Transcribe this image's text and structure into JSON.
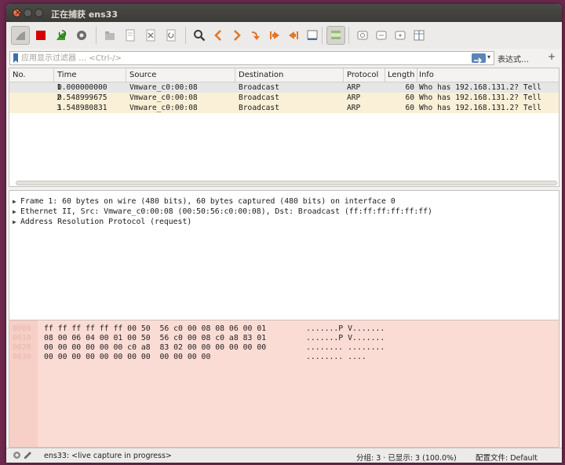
{
  "window": {
    "title": "正在捕获 ens33"
  },
  "filter": {
    "placeholder": "应用显示过滤器 … <Ctrl-/>",
    "expression_label": "表达式…",
    "add_label": "+"
  },
  "packet_list": {
    "columns": [
      "No.",
      "Time",
      "Source",
      "Destination",
      "Protocol",
      "Length",
      "Info"
    ],
    "rows": [
      {
        "no": "1",
        "time": "0.000000000",
        "source": "Vmware_c0:00:08",
        "destination": "Broadcast",
        "protocol": "ARP",
        "length": "60",
        "info": "Who has 192.168.131.2? Tell"
      },
      {
        "no": "2",
        "time": "0.548999675",
        "source": "Vmware_c0:00:08",
        "destination": "Broadcast",
        "protocol": "ARP",
        "length": "60",
        "info": "Who has 192.168.131.2? Tell"
      },
      {
        "no": "3",
        "time": "1.548980831",
        "source": "Vmware_c0:00:08",
        "destination": "Broadcast",
        "protocol": "ARP",
        "length": "60",
        "info": "Who has 192.168.131.2? Tell"
      }
    ]
  },
  "details": {
    "lines": [
      "Frame 1: 60 bytes on wire (480 bits), 60 bytes captured (480 bits) on interface 0",
      "Ethernet II, Src: Vmware_c0:00:08 (00:50:56:c0:00:08), Dst: Broadcast (ff:ff:ff:ff:ff:ff)",
      "Address Resolution Protocol (request)"
    ]
  },
  "bytes": {
    "rows": [
      {
        "offset": "0000",
        "hex": "ff ff ff ff ff ff 00 50  56 c0 00 08 08 06 00 01",
        "ascii": ".......P V......."
      },
      {
        "offset": "0010",
        "hex": "08 00 06 04 00 01 00 50  56 c0 00 08 c0 a8 83 01",
        "ascii": ".......P V......."
      },
      {
        "offset": "0020",
        "hex": "00 00 00 00 00 00 c0 a8  83 02 00 00 00 00 00 00",
        "ascii": "........ ........"
      },
      {
        "offset": "0030",
        "hex": "00 00 00 00 00 00 00 00  00 00 00 00",
        "ascii": "........ ...."
      }
    ]
  },
  "status": {
    "capture_text": "ens33: <live capture in progress>",
    "packets_text": "分组: 3 · 已显示: 3 (100.0%)",
    "profile_text": "配置文件: Default"
  },
  "colors": {
    "row_highlight": "#faf0d7",
    "selected_row": "#e6e6e6",
    "bytes_bg": "#fbdcd5",
    "stop_red": "#d40000",
    "nav_orange": "#e0772a",
    "shark_green": "#3c9c2a"
  },
  "icons": [
    "shark-fin-start-icon",
    "stop-capture-icon",
    "restart-capture-icon",
    "capture-options-icon",
    "open-file-icon",
    "save-file-icon",
    "close-file-icon",
    "reload-icon",
    "find-packet-icon",
    "go-back-icon",
    "go-forward-icon",
    "go-to-packet-icon",
    "go-first-icon",
    "go-last-icon",
    "autoscroll-icon",
    "colorize-icon",
    "zoom-in-icon",
    "zoom-out-icon",
    "normal-size-icon",
    "resize-columns-icon",
    "bookmark-icon",
    "expert-info-icon",
    "edit-capture-comment-icon"
  ]
}
